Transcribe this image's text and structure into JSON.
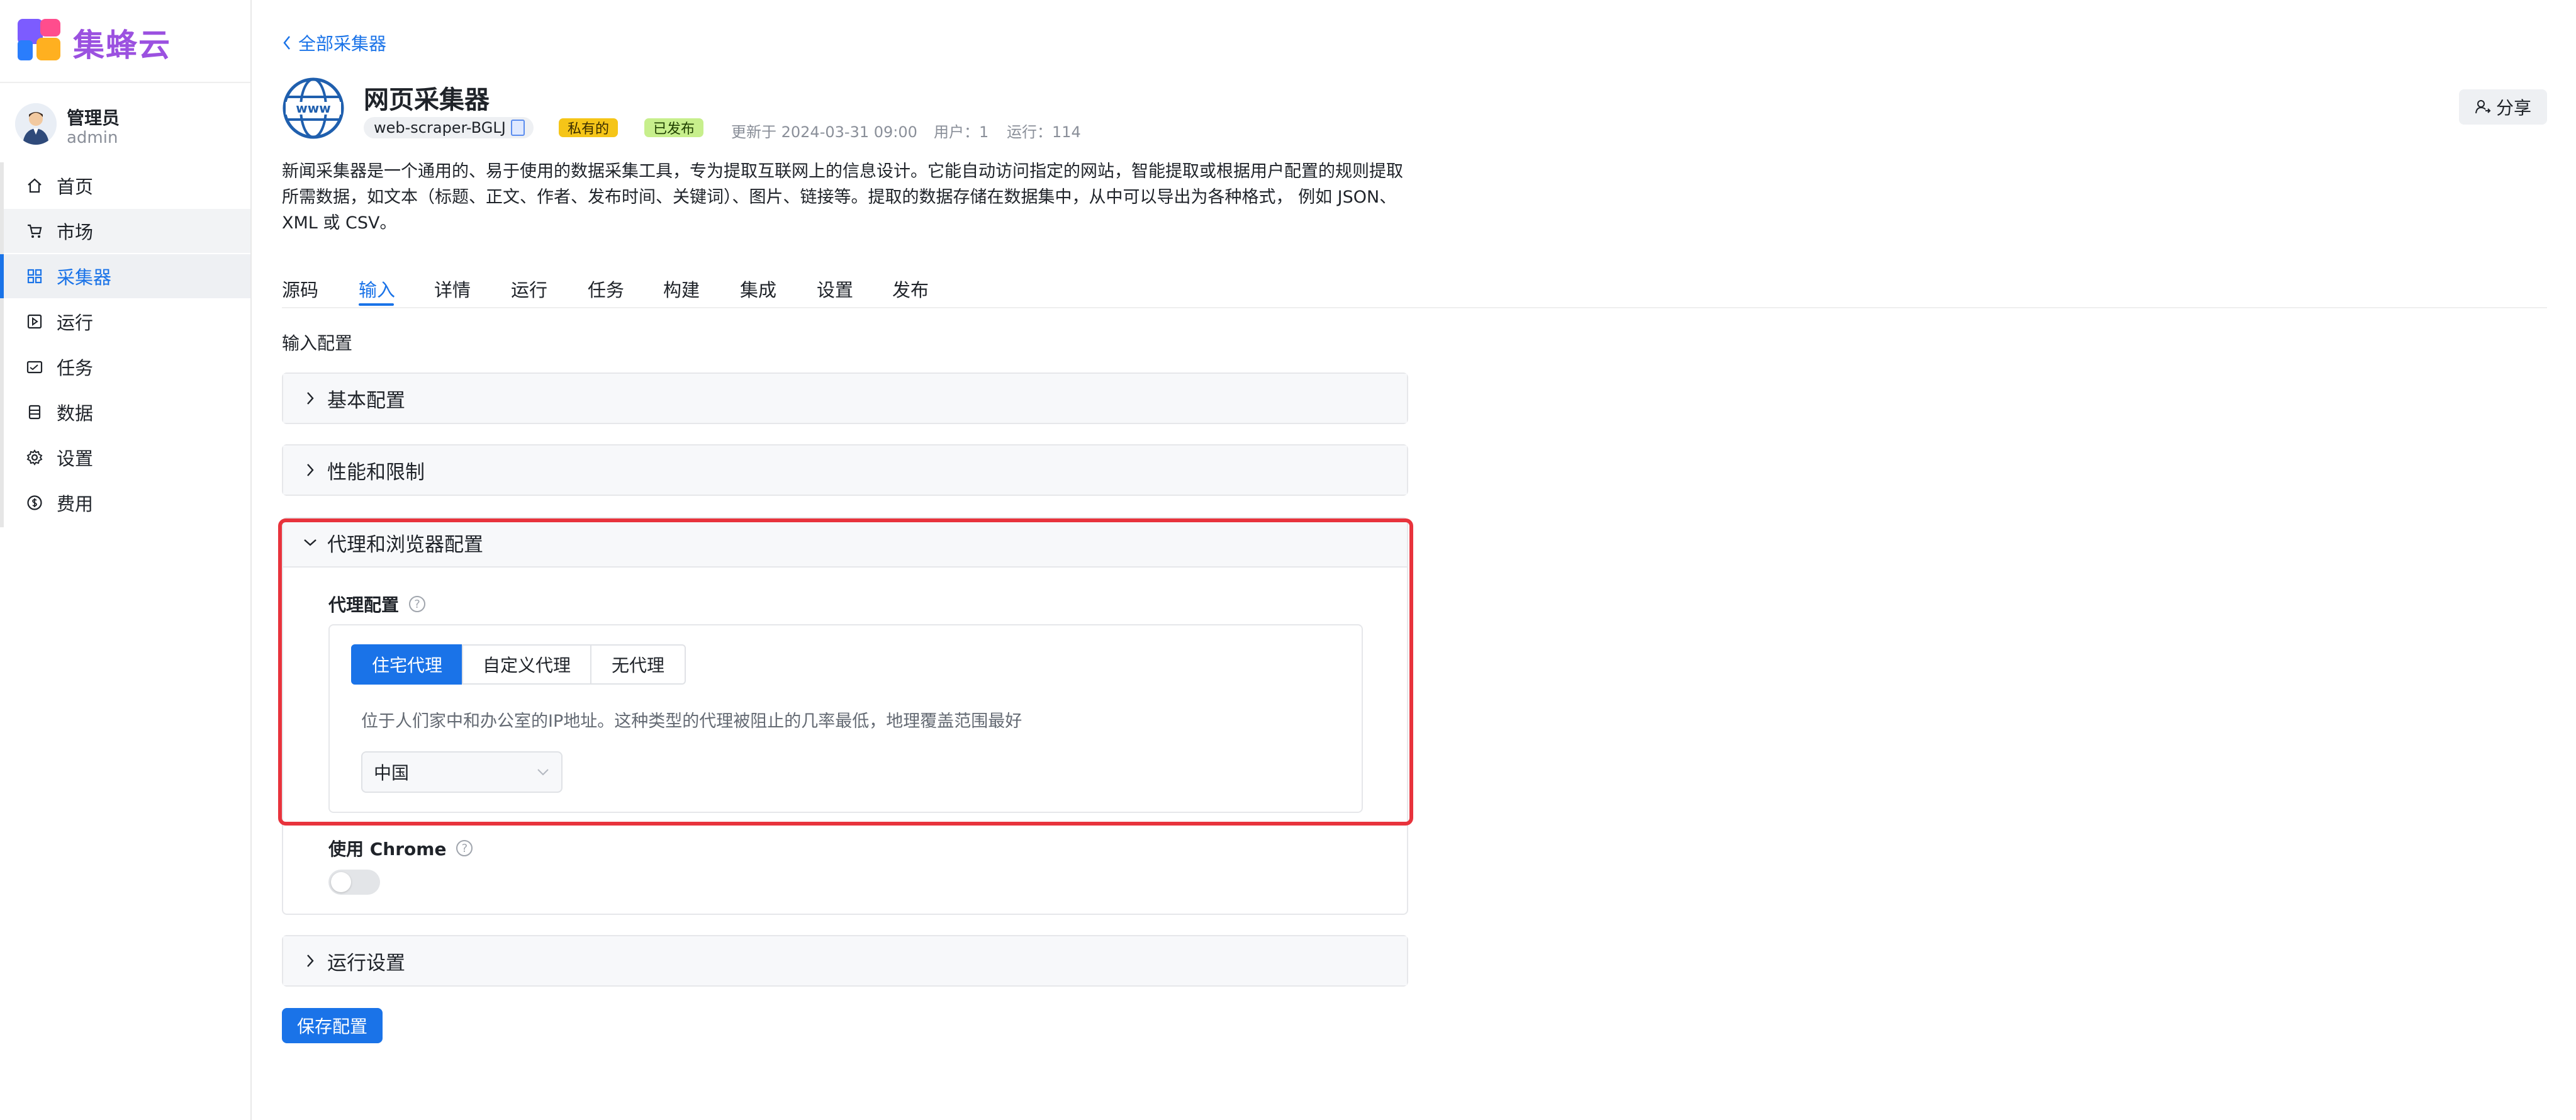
{
  "brand": {
    "name": "集蜂云",
    "colors": {
      "brand": "#9b51e0",
      "accent": "#1a73e8",
      "highlight": "#e8333c"
    }
  },
  "user": {
    "name": "管理员",
    "id": "admin"
  },
  "nav": {
    "items": [
      {
        "label": "首页",
        "icon": "home-icon"
      },
      {
        "label": "市场",
        "icon": "cart-icon"
      },
      {
        "label": "采集器",
        "icon": "grid-icon",
        "active": true
      },
      {
        "label": "运行",
        "icon": "play-square-icon"
      },
      {
        "label": "任务",
        "icon": "calendar-icon"
      },
      {
        "label": "数据",
        "icon": "database-icon"
      },
      {
        "label": "设置",
        "icon": "gear-icon"
      },
      {
        "label": "费用",
        "icon": "dollar-icon"
      }
    ]
  },
  "header": {
    "back_label": "全部采集器",
    "title": "网页采集器",
    "slug": "web-scraper-BGLJ",
    "tags": {
      "private": "私有的",
      "published": "已发布"
    },
    "updated": "更新于 2024-03-31 09:00",
    "users": "用户：1",
    "runs": "运行：114",
    "share_label": "分享",
    "description": "新闻采集器是一个通用的、易于使用的数据采集工具，专为提取互联网上的信息设计。它能自动访问指定的网站，智能提取或根据用户配置的规则提取所需数据，如文本（标题、正文、作者、发布时间、关键词）、图片、链接等。提取的数据存储在数据集中，从中可以导出为各种格式， 例如 JSON、XML 或 CSV。"
  },
  "tabs": [
    "源码",
    "输入",
    "详情",
    "运行",
    "任务",
    "构建",
    "集成",
    "设置",
    "发布"
  ],
  "active_tab": "输入",
  "input_config": {
    "section_label": "输入配置",
    "panels": {
      "basic": "基本配置",
      "perf": "性能和限制",
      "proxy": "代理和浏览器配置",
      "run": "运行设置"
    },
    "proxy": {
      "label": "代理配置",
      "options": [
        "住宅代理",
        "自定义代理",
        "无代理"
      ],
      "selected": "住宅代理",
      "description": "位于人们家中和办公室的IP地址。这种类型的代理被阻止的几率最低，地理覆盖范围最好",
      "country": "中国"
    },
    "chrome": {
      "label": "使用 Chrome",
      "enabled": false
    }
  },
  "save_label": "保存配置"
}
